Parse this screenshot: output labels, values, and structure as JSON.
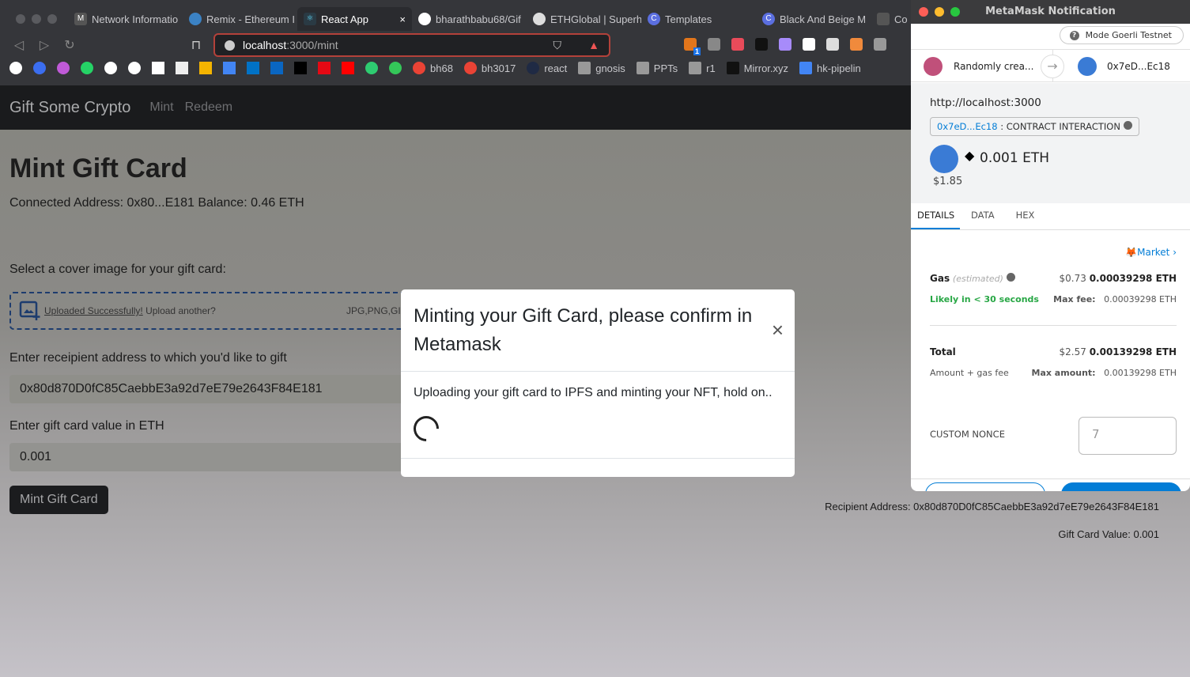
{
  "browser": {
    "tabs": [
      {
        "label": "Network Informatio",
        "icon": "M"
      },
      {
        "label": "Remix - Ethereum I",
        "icon": ""
      },
      {
        "label": "React App",
        "icon": "⚛",
        "active": true
      },
      {
        "label": "bharathbabu68/Gif",
        "icon": ""
      },
      {
        "label": "ETHGlobal | Superh",
        "icon": ""
      },
      {
        "label": "Templates",
        "icon": "C"
      },
      {
        "label": "Black And Beige M",
        "icon": "C"
      },
      {
        "label": "Co",
        "icon": ""
      }
    ],
    "tab_close": "×",
    "url_host": "localhost",
    "url_path": ":3000/mint",
    "bookmarks": [
      "bh68",
      "bh3017",
      "react",
      "gnosis",
      "PPTs",
      "r1",
      "Mirror.xyz",
      "hk-pipelin"
    ],
    "extension_badge": "1"
  },
  "app": {
    "brand": "Gift Some Crypto",
    "nav": [
      "Mint",
      "Redeem"
    ],
    "title": "Mint Gift Card",
    "connected": "Connected Address: 0x80...E181 Balance: 0.46 ETH",
    "cover_label": "Select a cover image for your gift card:",
    "upload_success": "Uploaded Successfully!",
    "upload_another": "Upload another?",
    "upload_types": "JPG,PNG,GIF",
    "recipient_label": "Enter receipient address to which you'd like to gift",
    "recipient_value": "0x80d870D0fC85CaebbE3a92d7eE79e2643F84E181",
    "value_label": "Enter gift card value in ETH",
    "value_value": "0.001",
    "mint_button": "Mint Gift Card",
    "recipient_summary": "Recipient Address: 0x80d870D0fC85CaebbE3a92d7eE79e2643F84E181",
    "value_summary": "Gift Card Value: 0.001"
  },
  "modal": {
    "title": "Minting your Gift Card, please confirm in Metamask",
    "close": "×",
    "body": "Uploading your gift card to IPFS and minting your NFT, hold on.."
  },
  "metamask": {
    "window_title": "MetaMask Notification",
    "network": "Mode Goerli Testnet",
    "from": "Randomly crea...",
    "to": "0x7eD...Ec18",
    "origin": "http://localhost:3000",
    "contract": "0x7eD...Ec18",
    "interaction": ": CONTRACT INTERACTION",
    "amount": "0.001 ETH",
    "fiat": "$1.85",
    "tabs": [
      "DETAILS",
      "DATA",
      "HEX"
    ],
    "market": "Market",
    "gas_label": "Gas",
    "gas_est": "(estimated)",
    "gas_fiat": "$0.73",
    "gas_eth": "0.00039298 ETH",
    "likely": "Likely in < 30 seconds",
    "maxfee_label": "Max fee:",
    "maxfee": "0.00039298 ETH",
    "total_label": "Total",
    "total_fiat": "$2.57",
    "total_eth": "0.00139298 ETH",
    "total_sub": "Amount + gas fee",
    "maxamt_label": "Max amount:",
    "maxamt": "0.00139298 ETH",
    "nonce_label": "CUSTOM NONCE",
    "nonce_placeholder": "7",
    "accent": "#037dd6",
    "success": "#28a745"
  }
}
